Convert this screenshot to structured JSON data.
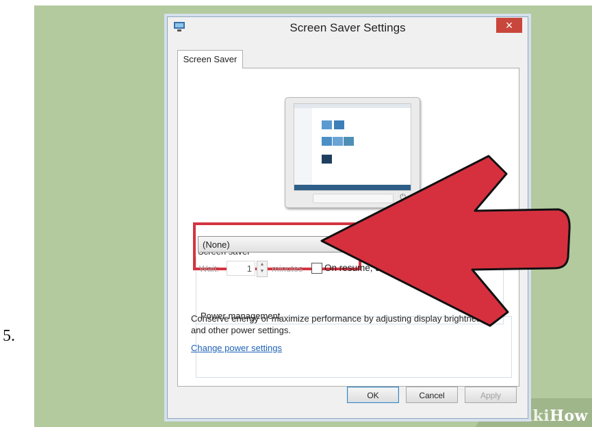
{
  "step": {
    "number": "5."
  },
  "watermark": {
    "wiki": "wiki",
    "how": "How"
  },
  "dialog": {
    "title": "Screen Saver Settings",
    "close_glyph": "×",
    "tab_label": "Screen Saver",
    "screen_saver_group_label": "Screen saver",
    "screen_saver_value": "(None)",
    "wait_label": "Wait:",
    "wait_value": "1",
    "minutes_label": "minutes",
    "resume_label": "On resume, display logon sc",
    "resume_checked": false,
    "power_group_label": "Power management",
    "power_description": "Conserve energy or maximize performance by adjusting display brightness and other power settings.",
    "power_link": "Change power settings",
    "buttons": {
      "ok": "OK",
      "cancel": "Cancel",
      "apply": "Apply"
    }
  },
  "colors": {
    "background": "#b3c99e",
    "highlight_box": "#d33441",
    "arrow_fill": "#d6303f",
    "link": "#1e62b8"
  },
  "icons": {
    "dropdown": "chevron-down-icon",
    "spinner": "up-down-arrows-icon",
    "monitor_preview": "monitor-icon",
    "arrow": "red-arrow-icon"
  }
}
